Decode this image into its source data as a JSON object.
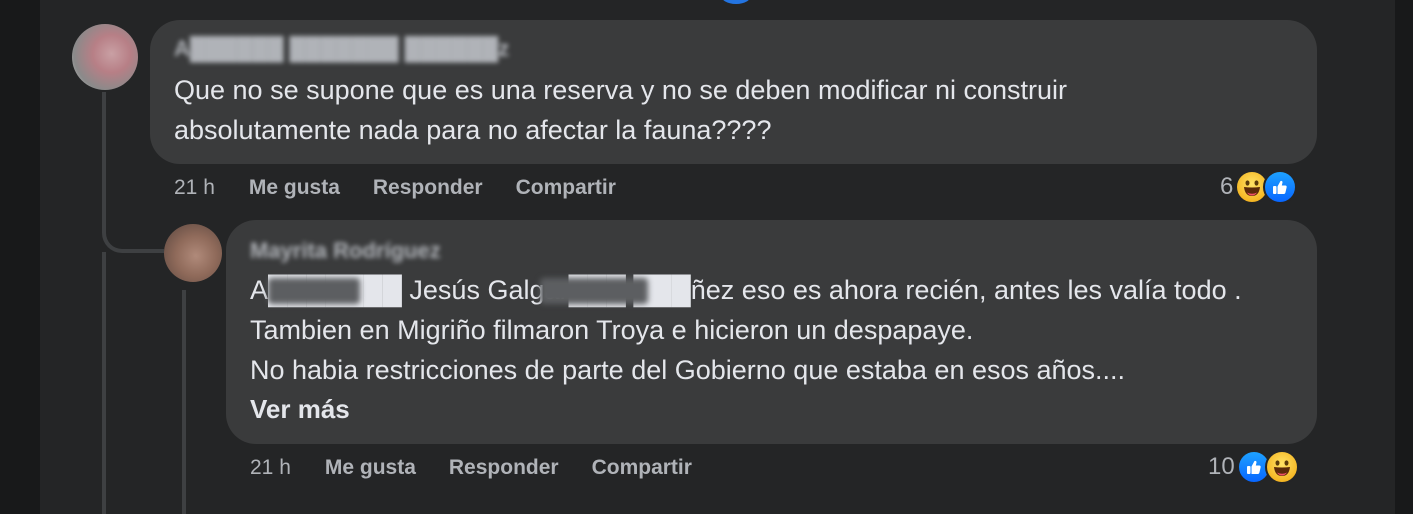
{
  "comments": [
    {
      "author": "A██████ ███████ ██████z",
      "text_lines": [
        "Que no se supone que es una reserva y no se deben modificar ni construir",
        "absolutamente nada para no afectar la fauna????"
      ],
      "time": "21 h",
      "actions": {
        "like": "Me gusta",
        "reply": "Responder",
        "share": "Compartir"
      },
      "reaction_count": "6",
      "reaction_icons": [
        "haha-icon",
        "like-icon"
      ]
    },
    {
      "author": "Mayrita Rodríguez",
      "text_lines": [
        "A███████ Jesús Galgar███ ███ñez eso es ahora recién, antes les valía todo .",
        "Tambien en Migriño filmaron Troya e hicieron un despapaye.",
        "No habia restricciones de parte del Gobierno que estaba en esos años...."
      ],
      "see_more": "Ver más",
      "time": "21 h",
      "actions": {
        "like": "Me gusta",
        "reply": "Responder",
        "share": "Compartir"
      },
      "reaction_count": "10",
      "reaction_icons": [
        "like-icon",
        "haha-icon"
      ]
    }
  ],
  "colors": {
    "background": "#18191a",
    "panel": "#242526",
    "bubble": "#3a3b3c",
    "text": "#e4e6eb",
    "secondary_text": "#b0b3b8",
    "like_blue": "#0866ff",
    "haha_yellow": "#f5b826"
  }
}
